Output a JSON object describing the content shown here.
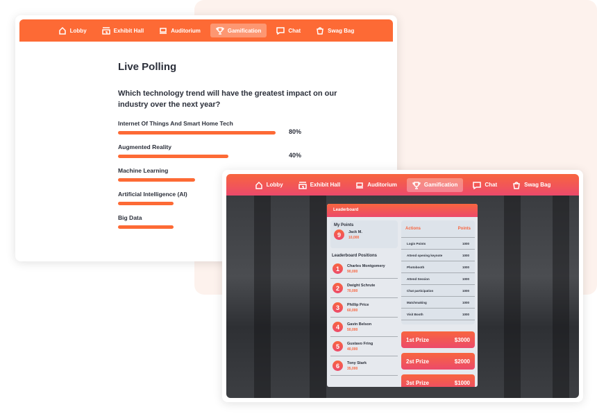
{
  "nav": [
    {
      "label": "Lobby",
      "icon": "home-icon"
    },
    {
      "label": "Exhibit Hall",
      "icon": "store-icon"
    },
    {
      "label": "Auditorium",
      "icon": "laptop-icon"
    },
    {
      "label": "Gamification",
      "icon": "trophy-icon",
      "active": true
    },
    {
      "label": "Chat",
      "icon": "chat-icon"
    },
    {
      "label": "Swag Bag",
      "icon": "bag-icon"
    }
  ],
  "poll": {
    "title": "Live Polling",
    "question": "Which technology trend will have the greatest impact on our industry over the next year?",
    "options": [
      {
        "label": "Internet Of Things And Smart Home Tech",
        "percent": "80%",
        "fill": 80
      },
      {
        "label": "Augmented Reality",
        "percent": "40%",
        "fill": 56
      },
      {
        "label": "Machine Learning",
        "fill": 39
      },
      {
        "label": "Artificial Intelligence (AI)",
        "fill": 28
      },
      {
        "label": "Big Data",
        "fill": 28
      }
    ]
  },
  "leaderboard": {
    "title": "Leaderboard",
    "my_points_label": "My Points",
    "me": {
      "rank": "9",
      "name": "Jack M.",
      "points": "10,000"
    },
    "positions_label": "Leaderboard Positions",
    "positions": [
      {
        "rank": "1",
        "name": "Charles Montgomery",
        "points": "90,000"
      },
      {
        "rank": "2",
        "name": "Dwight Schrute",
        "points": "70,000"
      },
      {
        "rank": "3",
        "name": "Phillip Price",
        "points": "60,000"
      },
      {
        "rank": "4",
        "name": "Gavin Belson",
        "points": "50,000"
      },
      {
        "rank": "5",
        "name": "Gustavo Fring",
        "points": "40,000"
      },
      {
        "rank": "6",
        "name": "Tony Stark",
        "points": "35,000"
      }
    ],
    "actions_header": "Actions",
    "points_header": "Points",
    "actions": [
      {
        "action": "Login Points",
        "points": "1000"
      },
      {
        "action": "Attend opening keynote",
        "points": "1000"
      },
      {
        "action": "Photobooth",
        "points": "1000"
      },
      {
        "action": "Attend Session",
        "points": "1000"
      },
      {
        "action": "Chat participation",
        "points": "1000"
      },
      {
        "action": "Matchmaking",
        "points": "1000"
      },
      {
        "action": "Visit Booth",
        "points": "1000"
      }
    ],
    "prizes": [
      {
        "label": "1st Prize",
        "amount": "$3000"
      },
      {
        "label": "2st Prize",
        "amount": "$2000"
      },
      {
        "label": "3st Prize",
        "amount": "$1000"
      }
    ]
  },
  "colors": {
    "accent": "#fd6a35",
    "gradient_end": "#ec4a6b"
  }
}
